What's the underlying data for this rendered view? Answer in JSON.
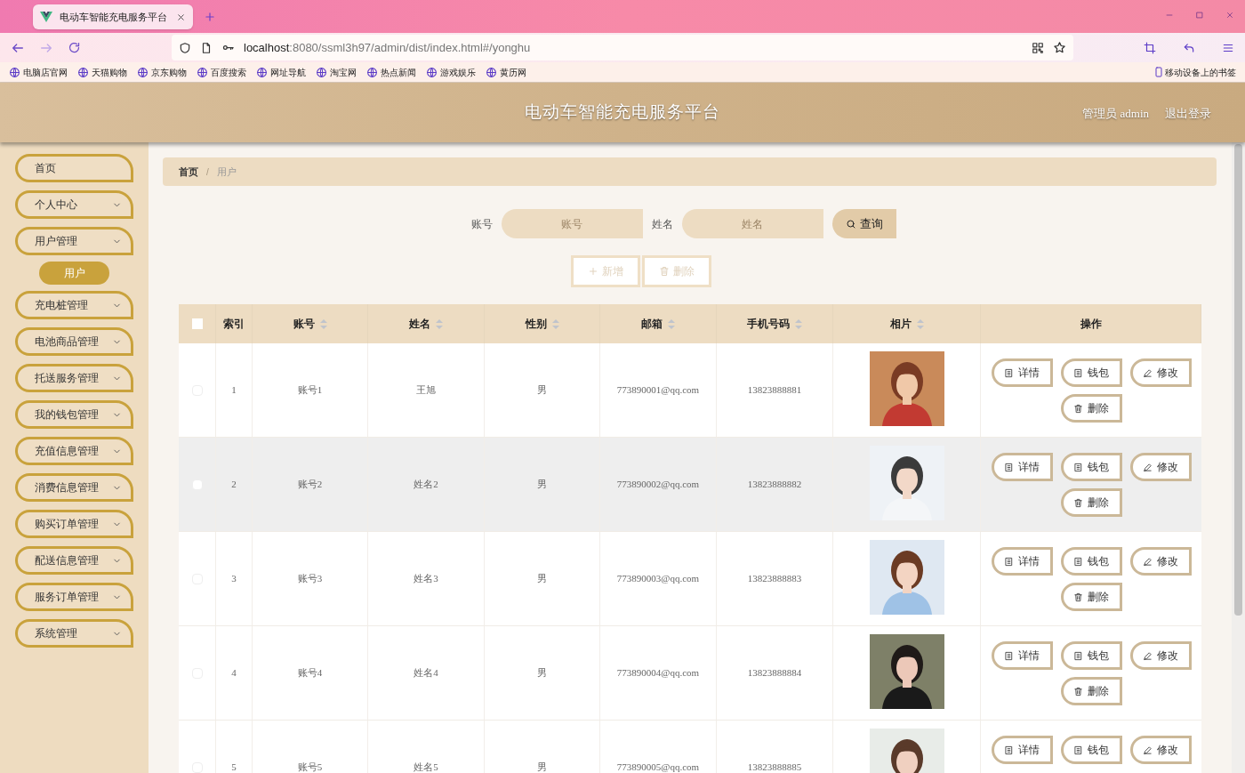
{
  "browser": {
    "tab": {
      "title": "电动车智能充电服务平台",
      "selected": true
    },
    "address": {
      "host": "localhost",
      "path": ":8080/ssml3h97/admin/dist/index.html#/yonghu"
    },
    "bookmarks": [
      "电脑店官网",
      "天猫购物",
      "京东购物",
      "百度搜索",
      "网址导航",
      "淘宝网",
      "热点新闻",
      "游戏娱乐",
      "黄历网"
    ],
    "mobile_bookmarks": "移动设备上的书签"
  },
  "header": {
    "title": "电动车智能充电服务平台",
    "user": "管理员 admin",
    "logout": "退出登录"
  },
  "sidebar": {
    "items": [
      {
        "kind": "link",
        "label": "首页"
      },
      {
        "kind": "menu",
        "label": "个人中心"
      },
      {
        "kind": "menu",
        "label": "用户管理",
        "children": [
          {
            "label": "用户",
            "selected": true
          }
        ]
      },
      {
        "kind": "menu",
        "label": "充电桩管理"
      },
      {
        "kind": "menu",
        "label": "电池商品管理"
      },
      {
        "kind": "menu",
        "label": "托送服务管理"
      },
      {
        "kind": "menu",
        "label": "我的钱包管理"
      },
      {
        "kind": "menu",
        "label": "充值信息管理"
      },
      {
        "kind": "menu",
        "label": "消费信息管理"
      },
      {
        "kind": "menu",
        "label": "购买订单管理"
      },
      {
        "kind": "menu",
        "label": "配送信息管理"
      },
      {
        "kind": "menu",
        "label": "服务订单管理"
      },
      {
        "kind": "menu",
        "label": "系统管理"
      }
    ]
  },
  "breadcrumb": [
    "首页",
    "用户"
  ],
  "breadcrumb_separator": "/",
  "search": {
    "fields": [
      {
        "label": "账号",
        "placeholder": "账号"
      },
      {
        "label": "姓名",
        "placeholder": "姓名"
      }
    ],
    "button": "查询"
  },
  "toolbar": [
    {
      "kind": "add",
      "label": "新增",
      "disabled": true
    },
    {
      "kind": "delete",
      "label": "删除",
      "disabled": true
    }
  ],
  "table": {
    "header_checked": false,
    "columns": [
      {
        "label": "索引",
        "sortable": false
      },
      {
        "label": "账号",
        "sortable": true
      },
      {
        "label": "姓名",
        "sortable": true
      },
      {
        "label": "性别",
        "sortable": true
      },
      {
        "label": "邮箱",
        "sortable": true
      },
      {
        "label": "手机号码",
        "sortable": true
      },
      {
        "label": "相片",
        "sortable": true
      },
      {
        "label": "操作",
        "sortable": false
      }
    ],
    "rows": [
      {
        "checked": false,
        "highlighted": false,
        "cells": [
          "1",
          "账号1",
          "王旭",
          "男",
          "773890001@qq.com",
          "13823888881"
        ],
        "photo": {
          "kind": "picture"
        },
        "actions": [
          {
            "kind": "detail",
            "label": "详情"
          },
          {
            "kind": "wallet",
            "label": "钱包"
          },
          {
            "kind": "edit",
            "label": "修改"
          },
          {
            "kind": "delete",
            "label": "删除"
          }
        ]
      },
      {
        "checked": false,
        "highlighted": true,
        "cells": [
          "2",
          "账号2",
          "姓名2",
          "男",
          "773890002@qq.com",
          "13823888882"
        ],
        "photo": {
          "kind": "picture"
        },
        "actions": [
          {
            "kind": "detail",
            "label": "详情"
          },
          {
            "kind": "wallet",
            "label": "钱包"
          },
          {
            "kind": "edit",
            "label": "修改"
          },
          {
            "kind": "delete",
            "label": "删除"
          }
        ]
      },
      {
        "checked": false,
        "highlighted": false,
        "cells": [
          "3",
          "账号3",
          "姓名3",
          "男",
          "773890003@qq.com",
          "13823888883"
        ],
        "photo": {
          "kind": "picture"
        },
        "actions": [
          {
            "kind": "detail",
            "label": "详情"
          },
          {
            "kind": "wallet",
            "label": "钱包"
          },
          {
            "kind": "edit",
            "label": "修改"
          },
          {
            "kind": "delete",
            "label": "删除"
          }
        ]
      },
      {
        "checked": false,
        "highlighted": false,
        "cells": [
          "4",
          "账号4",
          "姓名4",
          "男",
          "773890004@qq.com",
          "13823888884"
        ],
        "photo": {
          "kind": "picture"
        },
        "actions": [
          {
            "kind": "detail",
            "label": "详情"
          },
          {
            "kind": "wallet",
            "label": "钱包"
          },
          {
            "kind": "edit",
            "label": "修改"
          },
          {
            "kind": "delete",
            "label": "删除"
          }
        ]
      },
      {
        "checked": false,
        "highlighted": false,
        "cells": [
          "5",
          "账号5",
          "姓名5",
          "男",
          "773890005@qq.com",
          "13823888885"
        ],
        "photo": {
          "kind": "picture"
        },
        "actions": [
          {
            "kind": "detail",
            "label": "详情"
          },
          {
            "kind": "wallet",
            "label": "钱包"
          },
          {
            "kind": "edit",
            "label": "修改"
          }
        ]
      }
    ]
  }
}
